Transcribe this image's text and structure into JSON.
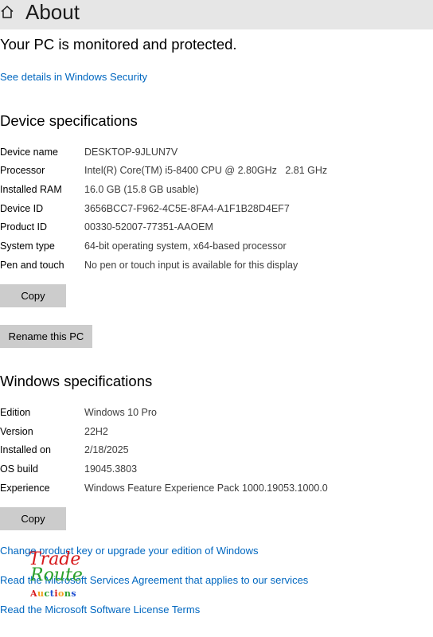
{
  "header": {
    "title": "About",
    "home_icon": "home-icon"
  },
  "protection": {
    "status": "Your PC is monitored and protected.",
    "details_link": "See details in Windows Security"
  },
  "device_specs": {
    "title": "Device specifications",
    "rows": [
      {
        "label": "Device name",
        "value": "DESKTOP-9JLUN7V"
      },
      {
        "label": "Processor",
        "value": "Intel(R) Core(TM) i5-8400 CPU @ 2.80GHz   2.81 GHz"
      },
      {
        "label": "Installed RAM",
        "value": "16.0 GB (15.8 GB usable)"
      },
      {
        "label": "Device ID",
        "value": "3656BCC7-F962-4C5E-8FA4-A1F1B28D4EF7"
      },
      {
        "label": "Product ID",
        "value": "00330-52007-77351-AAOEM"
      },
      {
        "label": "System type",
        "value": "64-bit operating system, x64-based processor"
      },
      {
        "label": "Pen and touch",
        "value": "No pen or touch input is available for this display"
      }
    ],
    "copy_label": "Copy",
    "rename_label": "Rename this PC"
  },
  "windows_specs": {
    "title": "Windows specifications",
    "rows": [
      {
        "label": "Edition",
        "value": "Windows 10 Pro"
      },
      {
        "label": "Version",
        "value": "22H2"
      },
      {
        "label": "Installed on",
        "value": "2/18/2025"
      },
      {
        "label": "OS build",
        "value": "19045.3803"
      },
      {
        "label": "Experience",
        "value": "Windows Feature Experience Pack 1000.19053.1000.0"
      }
    ],
    "copy_label": "Copy"
  },
  "links": {
    "product_key": "Change product key or upgrade your edition of Windows",
    "services_agreement": "Read the Microsoft Services Agreement that applies to our services",
    "license_terms": "Read the Microsoft Software License Terms"
  },
  "watermark": {
    "line1": "Trade",
    "line2": "Route",
    "line3": "Auctions",
    "line3_letter_colors": [
      "#d7191c",
      "#f29e1a",
      "#2aa02b",
      "#1f4fd1",
      "#d7191c",
      "#f29e1a",
      "#2aa02b",
      "#1f4fd1"
    ]
  }
}
